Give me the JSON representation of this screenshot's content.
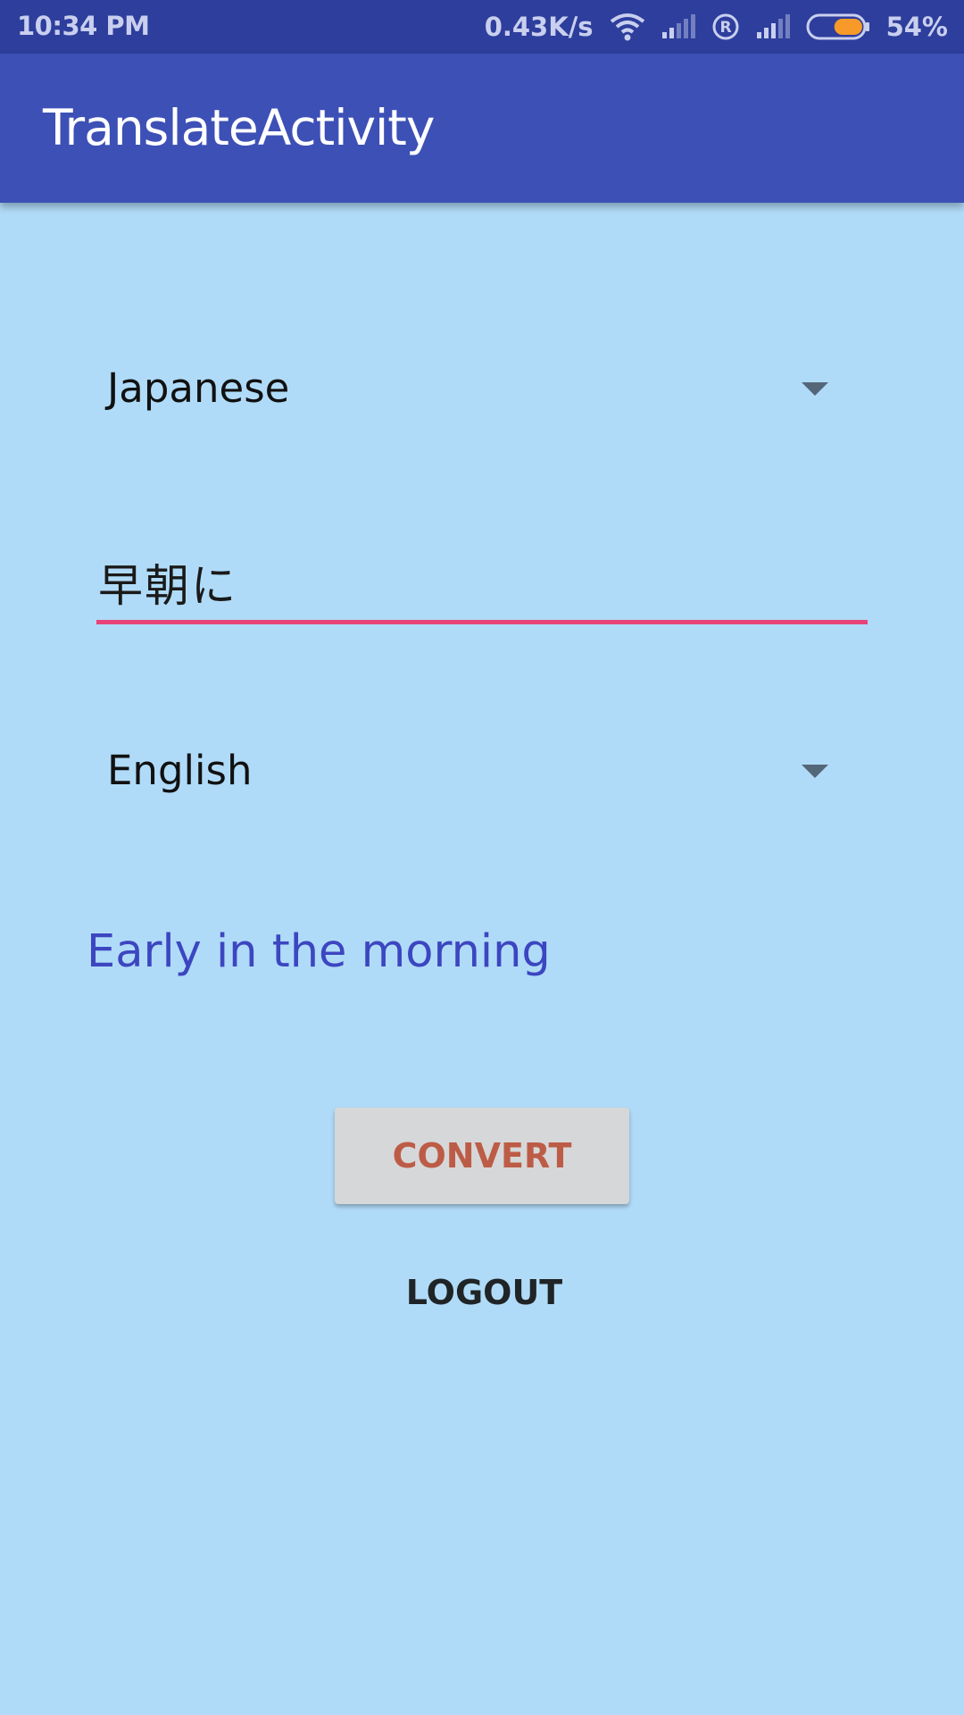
{
  "status_bar": {
    "time": "10:34 PM",
    "network_speed": "0.43K/s",
    "battery_percent": "54%",
    "battery_level": 0.54,
    "icons": [
      "wifi-icon",
      "signal-icon",
      "registered-icon",
      "signal-icon",
      "battery-icon"
    ]
  },
  "app_bar": {
    "title": "TranslateActivity"
  },
  "main": {
    "source_language": "Japanese",
    "input_text": "早朝に",
    "target_language": "English",
    "translated_text": "Early in the morning",
    "convert_label": "CONVERT",
    "logout_label": "LOGOUT"
  },
  "colors": {
    "status_bar": "#2d3e9c",
    "app_bar": "#3d50b6",
    "background": "#b0dbf8",
    "accent_underline": "#e84379",
    "result_text": "#3c46c0",
    "convert_text": "#bd5c46",
    "battery_fill": "#f79a2a"
  }
}
